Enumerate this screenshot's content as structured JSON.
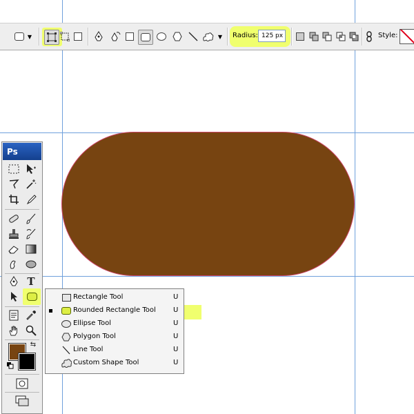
{
  "options_bar": {
    "radius_label": "Radius:",
    "radius_value": "125 px",
    "style_label": "Style:"
  },
  "toolbox": {
    "logo": "Ps",
    "text_tool_glyph": "T",
    "foreground_color": "#774411",
    "background_color": "#000000"
  },
  "canvas": {
    "shape_fill": "#774411",
    "guide_color": "#6fa0dc"
  },
  "flyout": {
    "items": [
      {
        "label": "Rectangle Tool",
        "shortcut": "U",
        "icon": "rectangle-icon",
        "selected": false
      },
      {
        "label": "Rounded Rectangle Tool",
        "shortcut": "U",
        "icon": "rounded-rectangle-icon",
        "selected": true
      },
      {
        "label": "Ellipse Tool",
        "shortcut": "U",
        "icon": "ellipse-icon",
        "selected": false
      },
      {
        "label": "Polygon Tool",
        "shortcut": "U",
        "icon": "polygon-icon",
        "selected": false
      },
      {
        "label": "Line Tool",
        "shortcut": "U",
        "icon": "line-icon",
        "selected": false
      },
      {
        "label": "Custom Shape Tool",
        "shortcut": "U",
        "icon": "custom-shape-icon",
        "selected": false
      }
    ]
  },
  "highlight_color": "#f0ff6e"
}
